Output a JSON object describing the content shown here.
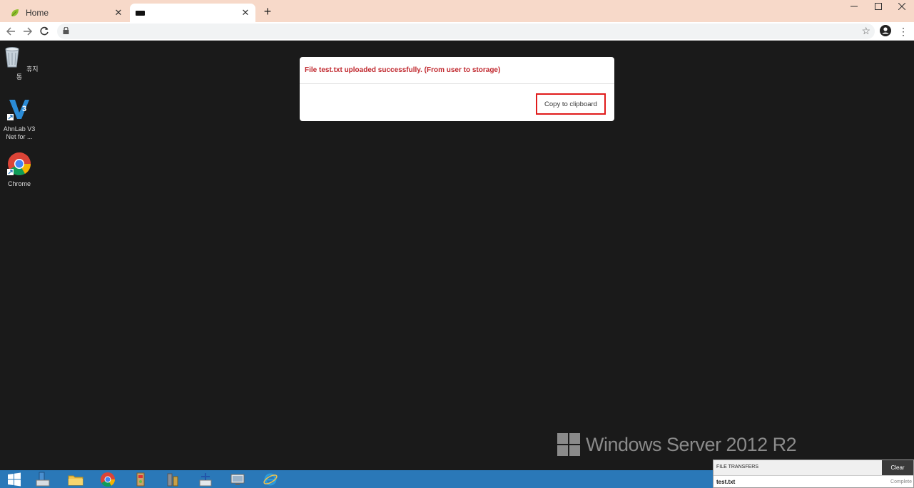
{
  "browser": {
    "tabs": [
      {
        "title": "Home",
        "favicon": "leaf-icon"
      },
      {
        "title": "",
        "favicon": "terminal-icon"
      }
    ],
    "new_tab": "+",
    "window_controls": [
      "minimize",
      "maximize",
      "close"
    ]
  },
  "desktop": {
    "icons": [
      {
        "label": "휴지통",
        "icon": "recycle-bin-icon"
      },
      {
        "label": "AhnLab V3 Net for ...",
        "icon": "ahnlab-v3-icon"
      },
      {
        "label": "Chrome",
        "icon": "chrome-icon"
      }
    ],
    "watermark": "Windows Server 2012 R2"
  },
  "dialog": {
    "message": "File test.txt uploaded successfully. (From user to storage)",
    "copy_button": "Copy to clipboard"
  },
  "taskbar": {
    "items": [
      "start-icon",
      "server-manager-icon",
      "file-explorer-icon",
      "chrome-icon",
      "app-icon",
      "tools-icon",
      "network-icon",
      "remote-desktop-icon",
      "internet-explorer-icon"
    ]
  },
  "file_transfers": {
    "title": "FILE TRANSFERS",
    "clear_label": "Clear",
    "files": [
      {
        "name": "test.txt",
        "status": "Complete"
      }
    ]
  },
  "colors": {
    "tabstrip": "#f7d9c9",
    "desktop": "#1a1a1a",
    "taskbar": "#2a78b8",
    "dialog_message": "#c0272d",
    "highlight": "#e01b1b"
  }
}
